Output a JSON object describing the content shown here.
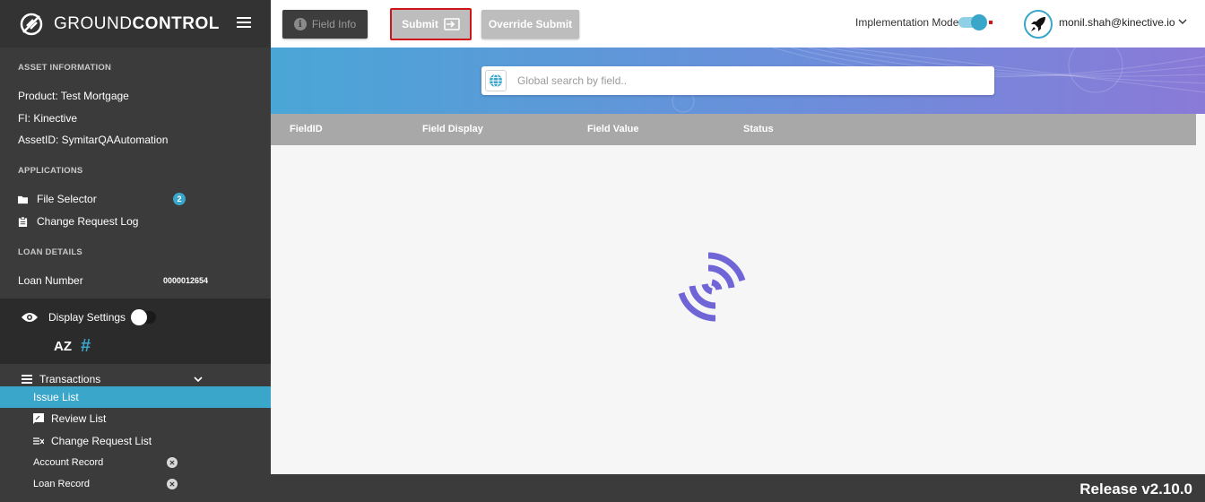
{
  "brand": {
    "name_thin": "GROUND",
    "name_bold": "CONTROL"
  },
  "sidebar": {
    "asset_title": "ASSET INFORMATION",
    "product": "Product:  Test Mortgage",
    "fi": "FI:  Kinective",
    "asset_id": "AssetID:  SymitarQAAutomation",
    "applications_title": "APPLICATIONS",
    "file_selector": "File Selector",
    "file_selector_badge": "2",
    "change_request_log": "Change Request Log",
    "loan_details_title": "LOAN DETAILS",
    "loan_number_label": "Loan Number",
    "loan_number_value": "0000012654",
    "display_settings": "Display Settings",
    "sort_az": "AZ",
    "hash": "#",
    "transactions": "Transactions",
    "issue_list": "Issue List",
    "review_list": "Review List",
    "change_request_list": "Change Request List",
    "account_record": "Account Record",
    "loan_record": "Loan Record"
  },
  "toolbar": {
    "field_info": "Field Info",
    "submit": "Submit",
    "override_submit": "Override Submit",
    "implementation_mode": "Implementation Mode",
    "user_email": "monil.shah@kinective.io"
  },
  "search": {
    "placeholder": "Global search by field.."
  },
  "table": {
    "columns": [
      "FieldID",
      "Field Display",
      "Field Value",
      "Status"
    ]
  },
  "footer": {
    "release": "Release v2.10.0"
  },
  "colors": {
    "accent": "#3aa6c9",
    "submit_border": "#d0151a",
    "spinner": "#7065d6"
  }
}
